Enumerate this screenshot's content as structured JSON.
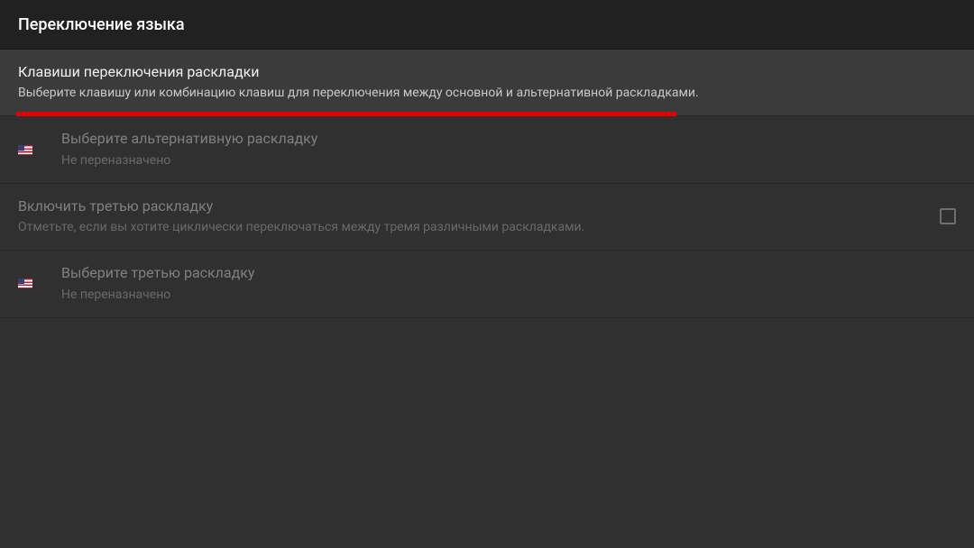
{
  "header": {
    "title": "Переключение языка"
  },
  "rows": {
    "switch_keys": {
      "title": "Клавиши переключения раскладки",
      "subtitle": "Выберите клавишу или комбинацию клавиш для переключения между основной и альтернативной раскладками."
    },
    "alt_layout": {
      "title": "Выберите альтернативную раскладку",
      "subtitle": "Не переназначено"
    },
    "enable_third": {
      "title": "Включить третью раскладку",
      "subtitle": "Отметьте, если вы хотите циклически переключаться между тремя различными раскладками."
    },
    "third_layout": {
      "title": "Выберите третью раскладку",
      "subtitle": "Не переназначено"
    }
  },
  "icons": {
    "flag": "us-flag"
  }
}
